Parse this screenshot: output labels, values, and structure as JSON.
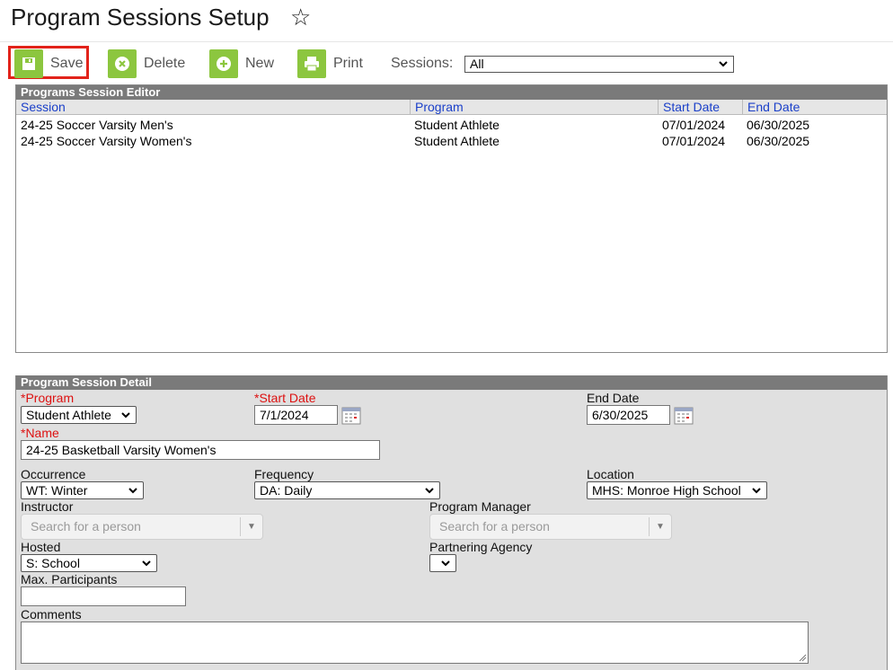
{
  "page": {
    "title": "Program Sessions Setup"
  },
  "toolbar": {
    "save_label": "Save",
    "delete_label": "Delete",
    "new_label": "New",
    "print_label": "Print",
    "sessions_label": "Sessions:",
    "sessions_value": "All"
  },
  "editor": {
    "title": "Programs Session Editor",
    "columns": [
      "Session",
      "Program",
      "Start Date",
      "End Date"
    ],
    "rows": [
      [
        "24-25 Soccer Varsity Men's",
        "Student Athlete",
        "07/01/2024",
        "06/30/2025"
      ],
      [
        "24-25 Soccer Varsity Women's",
        "Student Athlete",
        "07/01/2024",
        "06/30/2025"
      ]
    ]
  },
  "detail": {
    "title": "Program Session Detail",
    "program_label": "*Program",
    "program_value": "Student Athlete",
    "start_label": "*Start Date",
    "start_value": "7/1/2024",
    "end_label": "End Date",
    "end_value": "6/30/2025",
    "name_label": "*Name",
    "name_value": "24-25 Basketball Varsity Women's",
    "occurrence_label": "Occurrence",
    "occurrence_value": "WT: Winter",
    "frequency_label": "Frequency",
    "frequency_value": "DA: Daily",
    "location_label": "Location",
    "location_value": "MHS: Monroe High School",
    "instructor_label": "Instructor",
    "instructor_placeholder": "Search for a person",
    "manager_label": "Program Manager",
    "manager_placeholder": "Search for a person",
    "hosted_label": "Hosted",
    "hosted_value": "S: School",
    "agency_label": "Partnering Agency",
    "agency_value": "",
    "max_label": "Max. Participants",
    "max_value": "",
    "comments_label": "Comments"
  },
  "colors": {
    "accent_green": "#8cc63f",
    "highlight_red": "#e2231a",
    "link_blue": "#1a3fc9",
    "required_red": "#d11111"
  }
}
